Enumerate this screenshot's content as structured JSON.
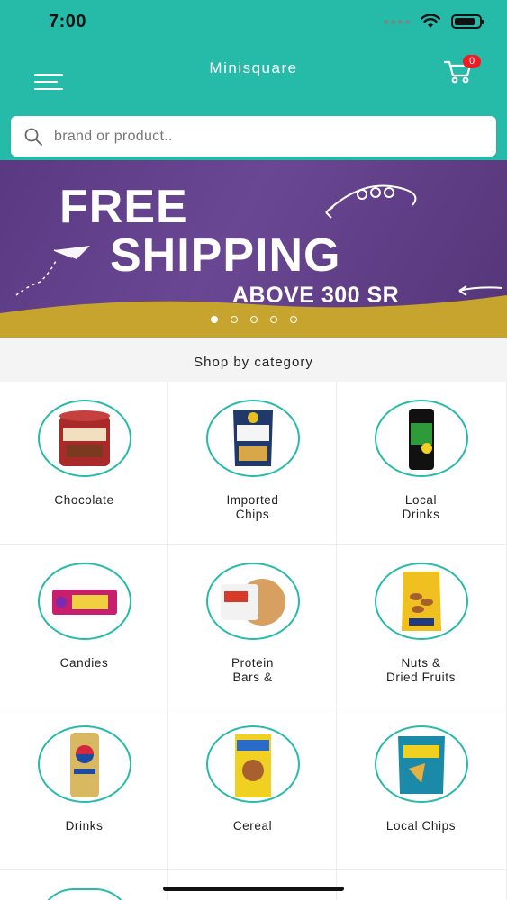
{
  "status_bar": {
    "time": "7:00"
  },
  "header": {
    "title": "Minisquare",
    "cart_count": "0",
    "menu_icon": "hamburger-menu-icon",
    "cart_icon": "shopping-cart-icon",
    "color": "#25bba8"
  },
  "search": {
    "placeholder": "brand or product.."
  },
  "banner": {
    "line1": "FREE",
    "line2": "SHIPPING",
    "line3": "ABOVE 300 SR",
    "slide_count": 5,
    "active_slide": 1,
    "background": "#5b3a84",
    "accent": "#c7a42e"
  },
  "categories_section": {
    "title": "Shop by category",
    "items": [
      {
        "label": "Chocolate",
        "icon": "almond-roca-tin-icon"
      },
      {
        "label": "Imported\nChips",
        "icon": "kettle-chips-bag-icon"
      },
      {
        "label": "Local\nDrinks",
        "icon": "green-can-icon"
      },
      {
        "label": "Candies",
        "icon": "bottle-caps-candy-icon"
      },
      {
        "label": "Protein\nBars &",
        "icon": "protein-cookie-icon"
      },
      {
        "label": "Nuts &\nDried Fruits",
        "icon": "almonds-bag-icon"
      },
      {
        "label": "Drinks",
        "icon": "pepsi-can-icon"
      },
      {
        "label": "Cereal",
        "icon": "nesquik-box-icon"
      },
      {
        "label": "Local Chips",
        "icon": "bugles-bag-icon"
      }
    ]
  }
}
